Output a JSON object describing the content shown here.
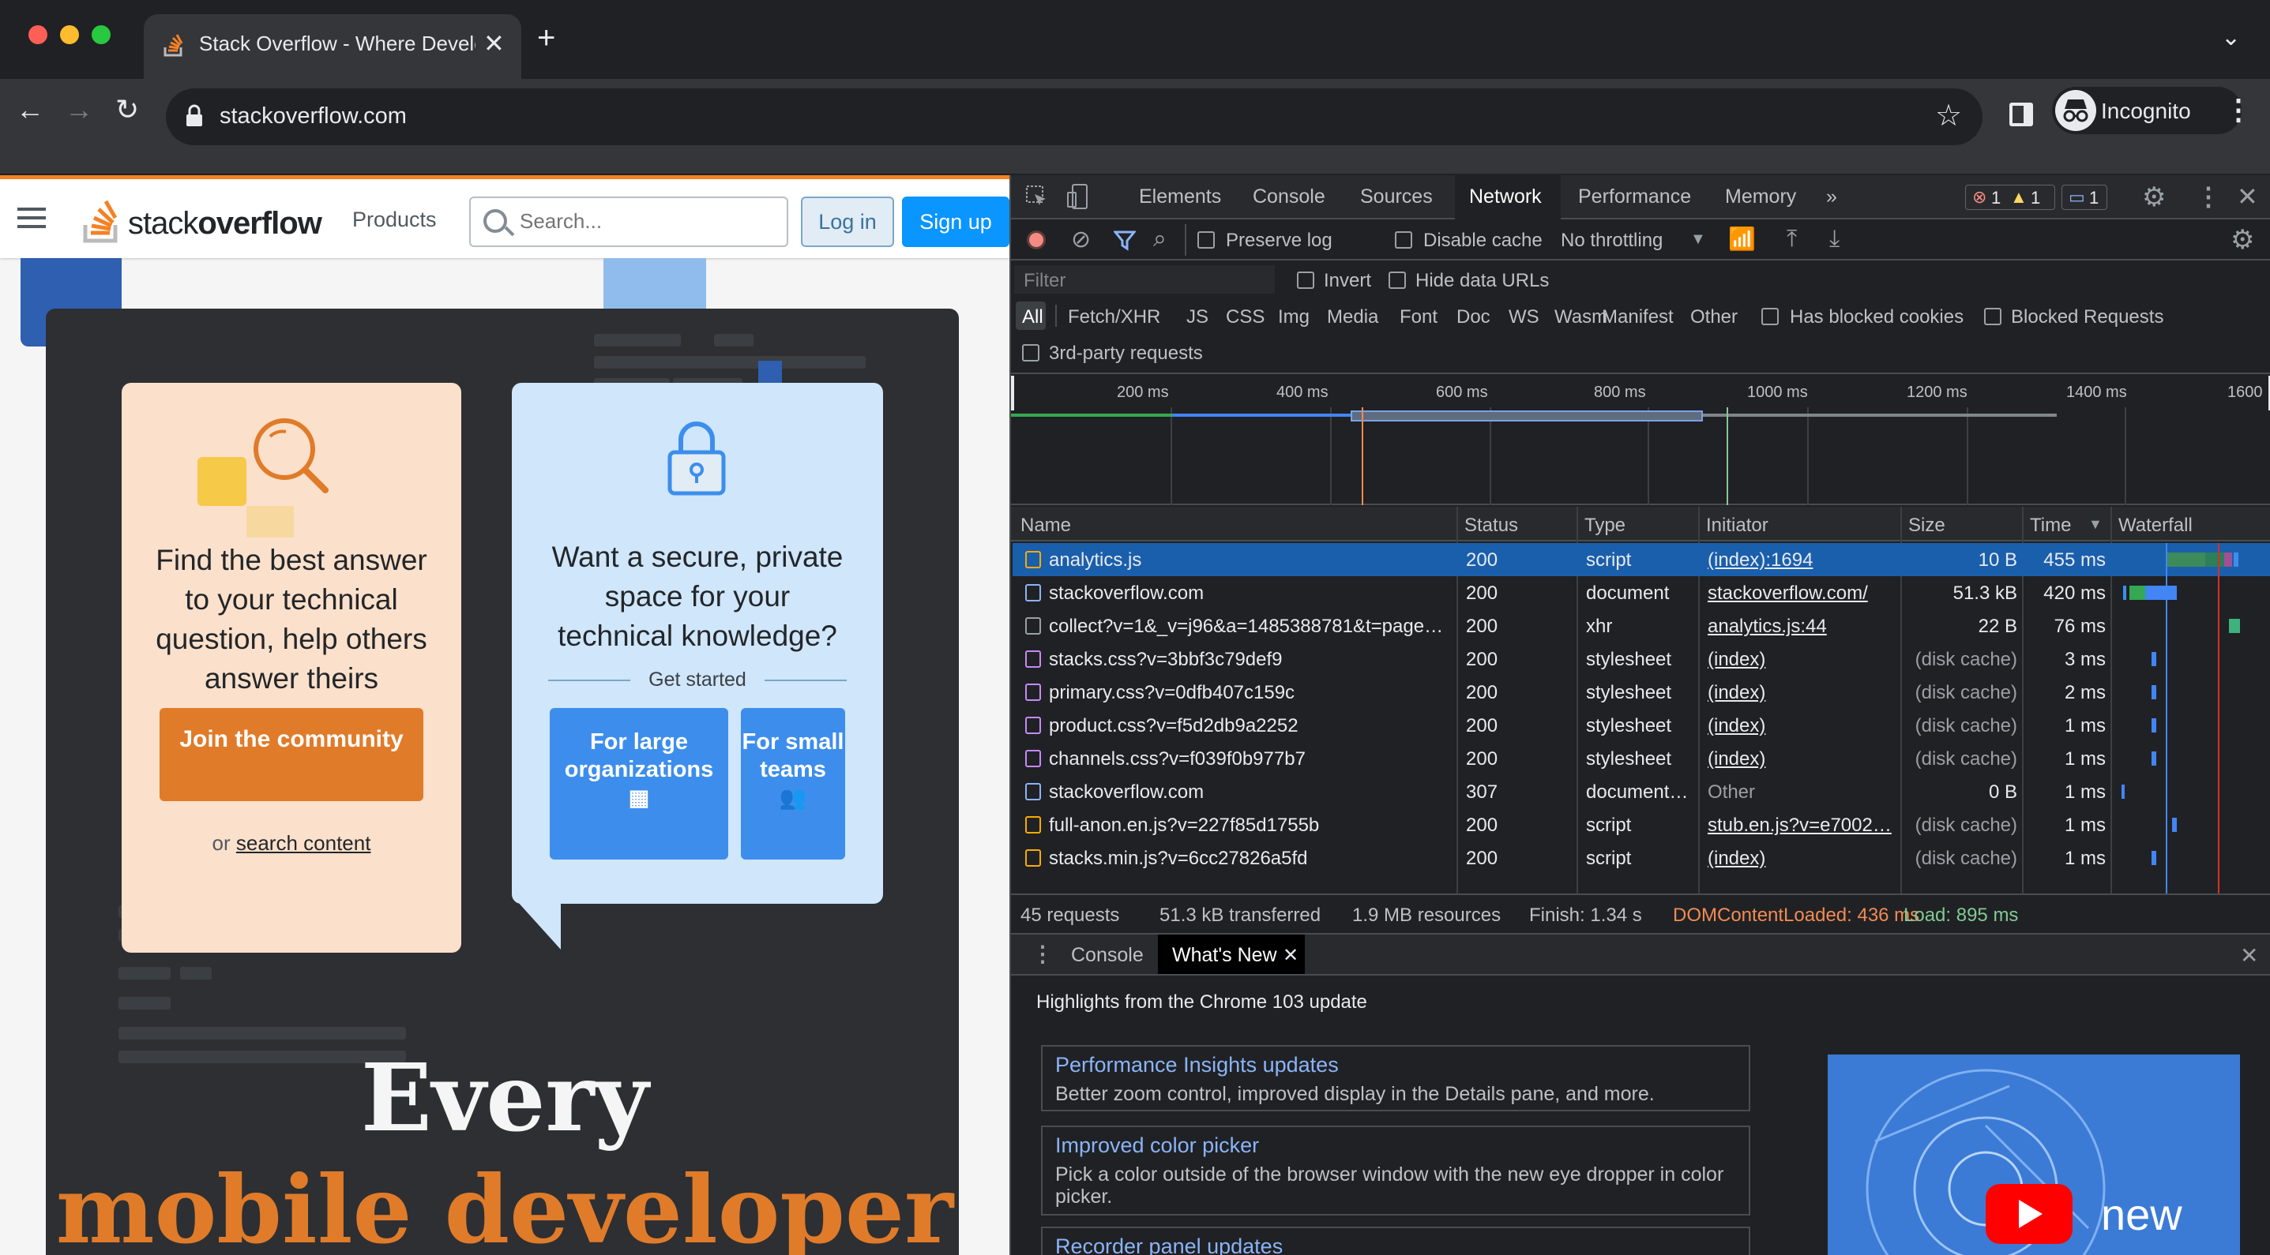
{
  "browser": {
    "tab_title": "Stack Overflow - Where Developers Learn, Share, & Build Careers",
    "url": "stackoverflow.com",
    "profile_label": "Incognito",
    "new_tab_glyph": "+",
    "close_glyph": "✕"
  },
  "so": {
    "logo_light": "stack",
    "logo_bold": "overflow",
    "products": "Products",
    "search_placeholder": "Search...",
    "login": "Log in",
    "signup": "Sign up",
    "card1_text": "Find the best answer to your technical question, help others answer theirs",
    "card1_button": "Join the community",
    "card1_or": "or",
    "card1_link": "search content",
    "card2_text": "Want a secure, private space for your technical knowledge?",
    "card2_get_started": "Get started",
    "card2_btn1": "For large organizations",
    "card2_btn2": "For small teams",
    "hero_line1": "Every",
    "hero_line2": "mobile developer",
    "accent": "#f48225"
  },
  "devtools": {
    "tabs": [
      "Elements",
      "Console",
      "Sources",
      "Network",
      "Performance",
      "Memory"
    ],
    "active_tab": "Network",
    "more_tabs": "»",
    "badges": {
      "errors": "1",
      "warnings": "1",
      "messages": "1"
    },
    "toolbar": {
      "preserve_log": "Preserve log",
      "disable_cache": "Disable cache",
      "throttling": "No throttling"
    },
    "filter": {
      "placeholder": "Filter",
      "invert": "Invert",
      "hide_data_urls": "Hide data URLs",
      "types": [
        "All",
        "Fetch/XHR",
        "JS",
        "CSS",
        "Img",
        "Media",
        "Font",
        "Doc",
        "WS",
        "Wasm",
        "Manifest",
        "Other"
      ],
      "has_blocked_cookies": "Has blocked cookies",
      "blocked_requests": "Blocked Requests",
      "third_party": "3rd-party requests"
    },
    "timeline_ticks": [
      "200 ms",
      "400 ms",
      "600 ms",
      "800 ms",
      "1000 ms",
      "1200 ms",
      "1400 ms",
      "1600"
    ],
    "columns": [
      "Name",
      "Status",
      "Type",
      "Initiator",
      "Size",
      "Time",
      "Waterfall"
    ],
    "rows": [
      {
        "name": "analytics.js",
        "status": "200",
        "type": "script",
        "initiator": "(index):1694",
        "size": "10 B",
        "time": "455 ms",
        "icon": "script-icon",
        "color": "#f9ab00"
      },
      {
        "name": "stackoverflow.com",
        "status": "200",
        "type": "document",
        "initiator": "stackoverflow.com/",
        "size": "51.3 kB",
        "time": "420 ms",
        "icon": "document-icon",
        "color": "#8ab4f8"
      },
      {
        "name": "collect?v=1&_v=j96&a=1485388781&t=page…",
        "status": "200",
        "type": "xhr",
        "initiator": "analytics.js:44",
        "size": "22 B",
        "time": "76 ms",
        "icon": "xhr-icon",
        "color": "#9aa0a6"
      },
      {
        "name": "stacks.css?v=3bbf3c79def9",
        "status": "200",
        "type": "stylesheet",
        "initiator": "(index)",
        "size": "(disk cache)",
        "time": "3 ms",
        "icon": "stylesheet-icon",
        "color": "#c58af9"
      },
      {
        "name": "primary.css?v=0dfb407c159c",
        "status": "200",
        "type": "stylesheet",
        "initiator": "(index)",
        "size": "(disk cache)",
        "time": "2 ms",
        "icon": "stylesheet-icon",
        "color": "#c58af9"
      },
      {
        "name": "product.css?v=f5d2db9a2252",
        "status": "200",
        "type": "stylesheet",
        "initiator": "(index)",
        "size": "(disk cache)",
        "time": "1 ms",
        "icon": "stylesheet-icon",
        "color": "#c58af9"
      },
      {
        "name": "channels.css?v=f039f0b977b7",
        "status": "200",
        "type": "stylesheet",
        "initiator": "(index)",
        "size": "(disk cache)",
        "time": "1 ms",
        "icon": "stylesheet-icon",
        "color": "#c58af9"
      },
      {
        "name": "stackoverflow.com",
        "status": "307",
        "type": "document…",
        "initiator": "Other",
        "size": "0 B",
        "time": "1 ms",
        "icon": "document-icon",
        "color": "#8ab4f8"
      },
      {
        "name": "full-anon.en.js?v=227f85d1755b",
        "status": "200",
        "type": "script",
        "initiator": "stub.en.js?v=e7002…",
        "size": "(disk cache)",
        "time": "1 ms",
        "icon": "script-icon",
        "color": "#f9ab00"
      },
      {
        "name": "stacks.min.js?v=6cc27826a5fd",
        "status": "200",
        "type": "script",
        "initiator": "(index)",
        "size": "(disk cache)",
        "time": "1 ms",
        "icon": "script-icon",
        "color": "#f9ab00"
      }
    ],
    "summary": {
      "requests": "45 requests",
      "transferred": "51.3 kB transferred",
      "resources": "1.9 MB resources",
      "finish": "Finish: 1.34 s",
      "dcl": "DOMContentLoaded: 436 ms",
      "load": "Load: 895 ms",
      "dcl_color": "#f28b54",
      "load_color": "#81c995"
    },
    "drawer": {
      "tabs": [
        "Console",
        "What's New"
      ],
      "active": "What's New",
      "highlight_title": "Highlights from the Chrome 103 update",
      "items": [
        {
          "title": "Performance Insights updates",
          "desc": "Better zoom control, improved display in the Details pane, and more."
        },
        {
          "title": "Improved color picker",
          "desc": "Pick a color outside of the browser window with the new eye dropper in color picker."
        },
        {
          "title": "Recorder panel updates",
          "desc": ""
        }
      ],
      "video_caption": "new"
    }
  }
}
